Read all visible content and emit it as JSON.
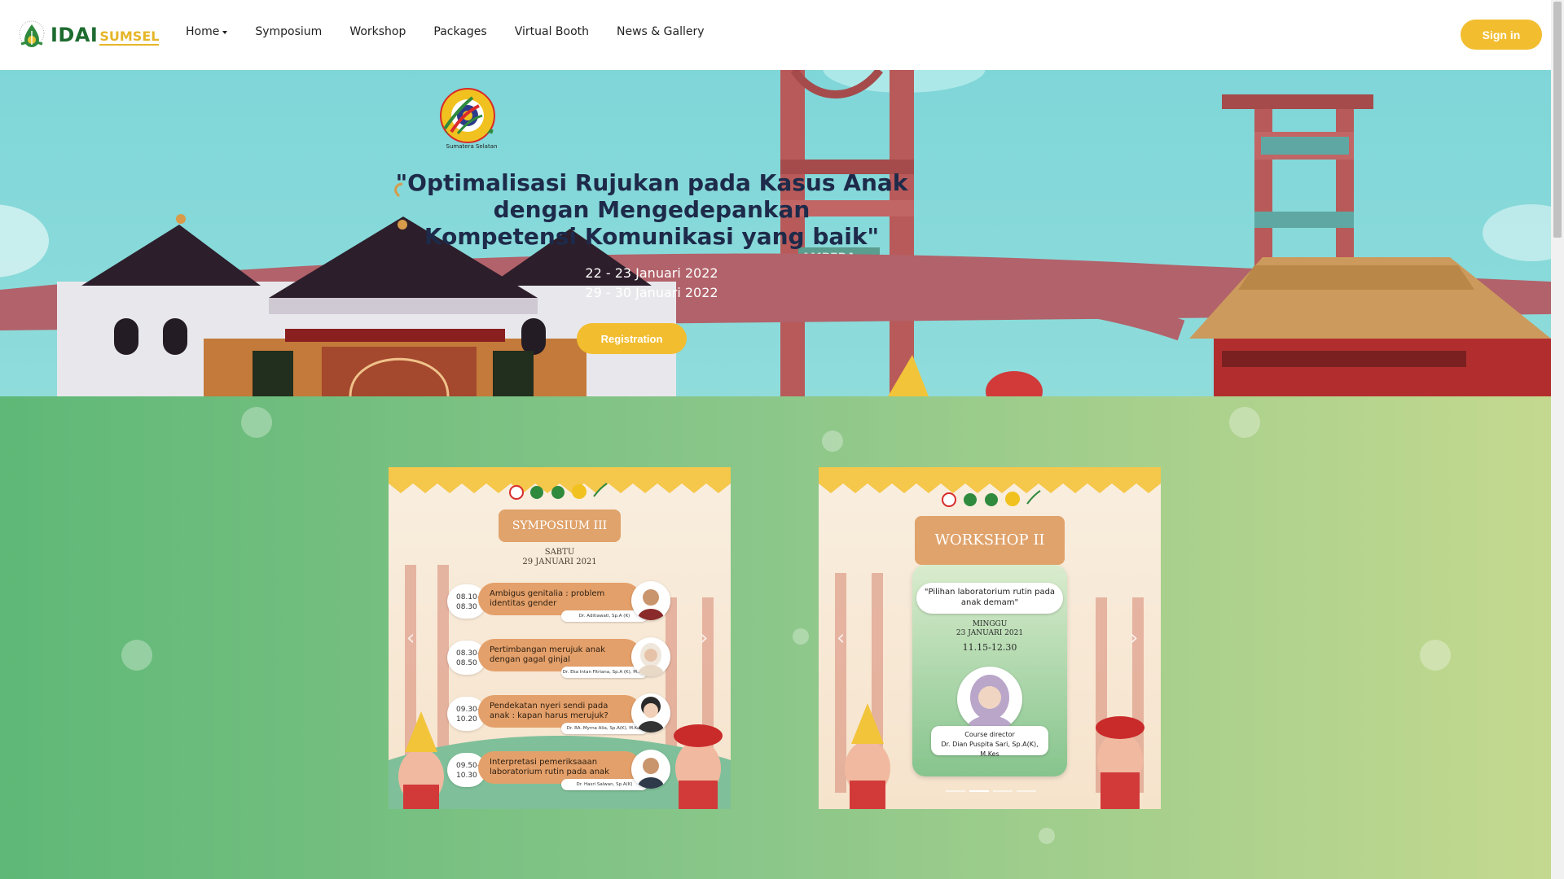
{
  "brand": {
    "name_primary": "IDAI",
    "name_secondary": "SUMSEL",
    "green": "#1d6b2f",
    "yellow": "#e6b628"
  },
  "nav": {
    "items": [
      {
        "label": "Home",
        "has_dropdown": true
      },
      {
        "label": "Symposium"
      },
      {
        "label": "Workshop"
      },
      {
        "label": "Packages"
      },
      {
        "label": "Virtual Booth"
      },
      {
        "label": "News & Gallery"
      }
    ],
    "signin_label": "Sign in"
  },
  "hero": {
    "title_lines": [
      "\"Optimalisasi Rujukan pada Kasus Anak",
      "dengan Mengedepankan",
      "Kompetensi Komunikasi yang baik\""
    ],
    "dates": [
      "22 - 23 Januari 2022",
      "29 - 30 Januari 2022"
    ],
    "registration_label": "Registration",
    "landmark_label": "AMPERA",
    "logo_caption": "Sumatera Selatan",
    "logos": [
      "ibi-logo",
      "idai-logo",
      "idai-sumsel-logo",
      "university-logo",
      "swoosh-logo"
    ]
  },
  "posters": {
    "symposium": {
      "title": "SYMPOSIUM III",
      "day": "SABTU",
      "date": "29 JANUARI 2021",
      "sessions": [
        {
          "time_start": "08.10-",
          "time_end": "08.30",
          "topic": "Ambigus genitalia : problem identitas gender",
          "speaker": "Dr. Aditiawati, Sp.A (K)"
        },
        {
          "time_start": "08.30-",
          "time_end": "08.50",
          "topic": "Pertimbangan merujuk anak dengan gagal ginjal",
          "speaker": "Dr. Eka Intan Fitriana, Sp.A (K), M.Kes"
        },
        {
          "time_start": "09.30-",
          "time_end": "10.20",
          "topic": "Pendekatan nyeri sendi pada anak : kapan harus merujuk?",
          "speaker": "Dr. RA. Myrna Alia, Sp.A(K), M.Kes"
        },
        {
          "time_start": "09.50-",
          "time_end": "10.30",
          "topic": "Interpretasi pemeriksaaan laboratorium rutin pada anak",
          "speaker": "Dr. Hasri Salwan, Sp.A(K)"
        }
      ]
    },
    "workshop": {
      "title": "WORKSHOP II",
      "quote": "\"Pilihan laboratorium rutin pada anak demam\"",
      "day": "MINGGU",
      "date": "23 JANUARI 2021",
      "time": "11.15-12.30",
      "director_role": "Course director",
      "director_name": "Dr. Dian Puspita Sari, Sp.A(K), M.Kes"
    },
    "carousel_active_index": 1,
    "carousel_count": 4
  }
}
